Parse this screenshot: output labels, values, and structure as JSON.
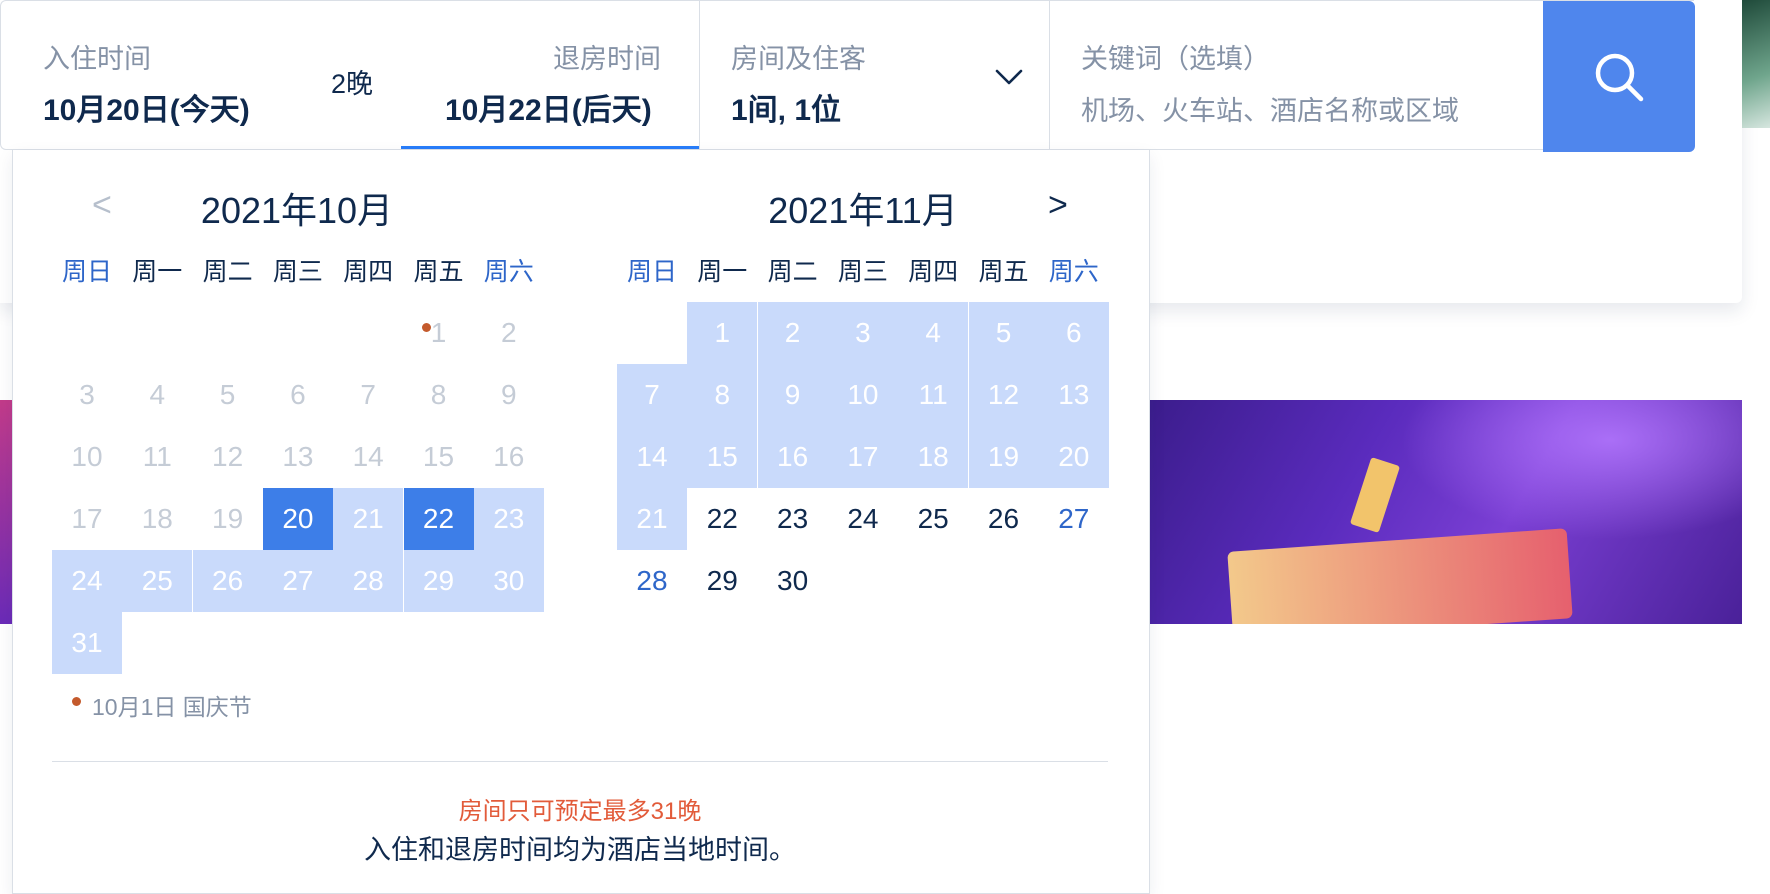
{
  "search": {
    "checkin_label": "入住时间",
    "checkin_value": "10月20日(今天)",
    "nights": "2晚",
    "checkout_label": "退房时间",
    "checkout_value": "10月22日(后天)",
    "rooms_label": "房间及住客",
    "rooms_value": "1间, 1位",
    "keyword_label": "关键词（选填）",
    "keyword_placeholder": "机场、火车站、酒店名称或区域",
    "accent_color": "#4f86ed"
  },
  "calendar": {
    "prev_symbol": "<",
    "next_symbol": ">",
    "weekdays": [
      "周日",
      "周一",
      "周二",
      "周三",
      "周四",
      "周五",
      "周六"
    ],
    "months": [
      {
        "title": "2021年10月",
        "days": [
          {
            "d": "1",
            "state": "past",
            "holiday": true
          },
          {
            "d": "2",
            "state": "past"
          },
          {
            "d": "3",
            "state": "past"
          },
          {
            "d": "4",
            "state": "past"
          },
          {
            "d": "5",
            "state": "past"
          },
          {
            "d": "6",
            "state": "past"
          },
          {
            "d": "7",
            "state": "past"
          },
          {
            "d": "8",
            "state": "past"
          },
          {
            "d": "9",
            "state": "past"
          },
          {
            "d": "10",
            "state": "past"
          },
          {
            "d": "11",
            "state": "past"
          },
          {
            "d": "12",
            "state": "past"
          },
          {
            "d": "13",
            "state": "past"
          },
          {
            "d": "14",
            "state": "past"
          },
          {
            "d": "15",
            "state": "past"
          },
          {
            "d": "16",
            "state": "past"
          },
          {
            "d": "17",
            "state": "past"
          },
          {
            "d": "18",
            "state": "past"
          },
          {
            "d": "19",
            "state": "past"
          },
          {
            "d": "20",
            "state": "selected"
          },
          {
            "d": "21",
            "state": "range"
          },
          {
            "d": "22",
            "state": "selected"
          },
          {
            "d": "23",
            "state": "range"
          },
          {
            "d": "24",
            "state": "range"
          },
          {
            "d": "25",
            "state": "range"
          },
          {
            "d": "26",
            "state": "range"
          },
          {
            "d": "27",
            "state": "range"
          },
          {
            "d": "28",
            "state": "range"
          },
          {
            "d": "29",
            "state": "range"
          },
          {
            "d": "30",
            "state": "range"
          },
          {
            "d": "31",
            "state": "range"
          }
        ]
      },
      {
        "title": "2021年11月",
        "days": [
          {
            "d": "1",
            "state": "range"
          },
          {
            "d": "2",
            "state": "range"
          },
          {
            "d": "3",
            "state": "range"
          },
          {
            "d": "4",
            "state": "range"
          },
          {
            "d": "5",
            "state": "range"
          },
          {
            "d": "6",
            "state": "range"
          },
          {
            "d": "7",
            "state": "range"
          },
          {
            "d": "8",
            "state": "range"
          },
          {
            "d": "9",
            "state": "range"
          },
          {
            "d": "10",
            "state": "range"
          },
          {
            "d": "11",
            "state": "range"
          },
          {
            "d": "12",
            "state": "range"
          },
          {
            "d": "13",
            "state": "range"
          },
          {
            "d": "14",
            "state": "range"
          },
          {
            "d": "15",
            "state": "range"
          },
          {
            "d": "16",
            "state": "range"
          },
          {
            "d": "17",
            "state": "range"
          },
          {
            "d": "18",
            "state": "range"
          },
          {
            "d": "19",
            "state": "range"
          },
          {
            "d": "20",
            "state": "range"
          },
          {
            "d": "21",
            "state": "range"
          },
          {
            "d": "22",
            "state": "normal"
          },
          {
            "d": "23",
            "state": "normal"
          },
          {
            "d": "24",
            "state": "normal"
          },
          {
            "d": "25",
            "state": "normal"
          },
          {
            "d": "26",
            "state": "normal"
          },
          {
            "d": "27",
            "state": "weekend"
          },
          {
            "d": "28",
            "state": "weekend"
          },
          {
            "d": "29",
            "state": "normal"
          },
          {
            "d": "30",
            "state": "normal"
          }
        ]
      }
    ],
    "holiday_legend": "10月1日 国庆节",
    "warning": "房间只可预定最多31晚",
    "note": "入住和退房时间均为酒店当地时间。"
  }
}
